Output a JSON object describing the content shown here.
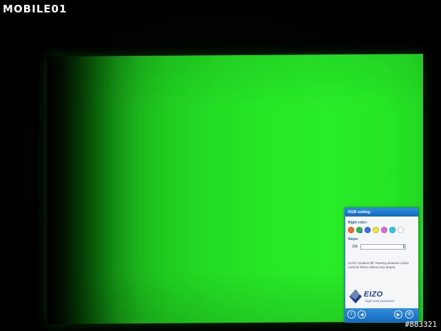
{
  "watermark": {
    "brand": "MOBILE01",
    "post_id": "#883321"
  },
  "screen": {
    "fill_color": "#27e827"
  },
  "panel": {
    "title": "RGB setting:",
    "color_label": "Right color:",
    "swatches": [
      {
        "name": "orange",
        "color": "#f06a2a"
      },
      {
        "name": "green",
        "color": "#22c03a",
        "selected": true
      },
      {
        "name": "blue",
        "color": "#3a6fe0"
      },
      {
        "name": "yellow",
        "color": "#f2e63a"
      },
      {
        "name": "magenta",
        "color": "#d86ad8"
      },
      {
        "name": "cyan",
        "color": "#28c8e8"
      },
      {
        "name": "white",
        "color": "#ffffff"
      }
    ],
    "steps_label": "Steps:",
    "steps_value": "256",
    "description": "21/24: Gradient fill: Passing between colors must be fluent without any stripes.",
    "brand_name": "EIZO",
    "brand_tagline": "high-end-monitors",
    "nav": {
      "info_icon": "info-icon",
      "back_icon": "arrow-left-icon",
      "forward_icon": "arrow-right-icon",
      "close_icon": "power-icon"
    }
  }
}
